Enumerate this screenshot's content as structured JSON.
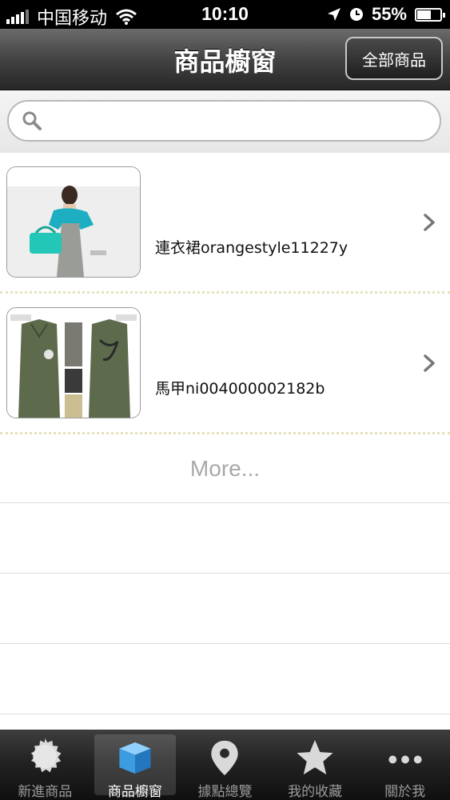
{
  "status_bar": {
    "carrier": "中国移动",
    "time": "10:10",
    "battery": "55%"
  },
  "nav": {
    "title": "商品櫥窗",
    "all_products_button": "全部商品"
  },
  "search": {
    "value": "",
    "placeholder": ""
  },
  "products": [
    {
      "name": "連衣裙orangestyle11227y"
    },
    {
      "name": "馬甲ni004000002182b"
    }
  ],
  "more_label": "More...",
  "tabs": [
    {
      "label": "新進商品",
      "icon": "badge-icon"
    },
    {
      "label": "商品櫥窗",
      "icon": "box-icon"
    },
    {
      "label": "據點總覽",
      "icon": "map-pin-icon"
    },
    {
      "label": "我的收藏",
      "icon": "star-icon"
    },
    {
      "label": "關於我",
      "icon": "more-dots-icon"
    }
  ],
  "active_tab_index": 1,
  "colors": {
    "accent_blue": "#3d9be0",
    "tab_active_text": "#ffffff",
    "tab_inactive_text": "#9a9a9a"
  }
}
